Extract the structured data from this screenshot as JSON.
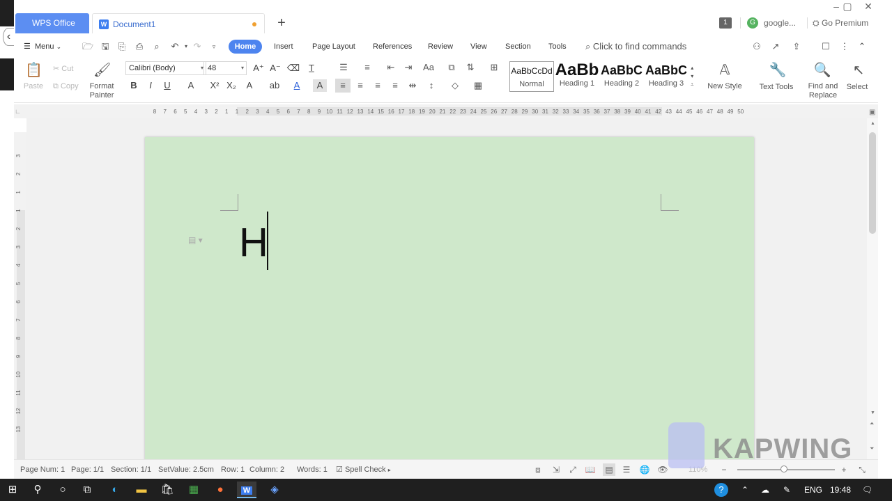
{
  "window": {
    "tabs": [
      {
        "label": "WPS Office"
      },
      {
        "label": "Document1"
      }
    ],
    "badge": "1",
    "account_initial": "G",
    "account_name": "google...",
    "premium": "Go Premium"
  },
  "menubar": {
    "menu_label": "Menu",
    "tabs": [
      "Home",
      "Insert",
      "Page Layout",
      "References",
      "Review",
      "View",
      "Section",
      "Tools"
    ],
    "command_search": "Click to find commands"
  },
  "ribbon": {
    "paste": "Paste",
    "cut": "Cut",
    "copy": "Copy",
    "format_painter": [
      "Format",
      "Painter"
    ],
    "font_name": "Calibri (Body)",
    "font_size": "48",
    "styles": [
      {
        "sample": "AaBbCcDd",
        "label": "Normal"
      },
      {
        "sample": "AaBb",
        "label": "Heading 1"
      },
      {
        "sample": "AaBbC",
        "label": "Heading 2"
      },
      {
        "sample": "AaBbC",
        "label": "Heading 3"
      }
    ],
    "new_style": "New Style",
    "text_tools": "Text Tools",
    "find_replace": [
      "Find and",
      "Replace"
    ],
    "select": "Select"
  },
  "ruler": {
    "ticks": [
      "8",
      "7",
      "6",
      "5",
      "4",
      "3",
      "2",
      "1",
      "1",
      "2",
      "3",
      "4",
      "5",
      "6",
      "7",
      "8",
      "9",
      "10",
      "11",
      "12",
      "13",
      "14",
      "15",
      "16",
      "17",
      "18",
      "19",
      "20",
      "21",
      "22",
      "23",
      "24",
      "25",
      "26",
      "27",
      "28",
      "29",
      "30",
      "31",
      "32",
      "33",
      "34",
      "35",
      "36",
      "37",
      "38",
      "39",
      "40",
      "41",
      "42",
      "43",
      "44",
      "45",
      "46",
      "47",
      "48",
      "49",
      "50"
    ],
    "vticks": [
      "3",
      "2",
      "1",
      "1",
      "2",
      "3",
      "4",
      "5",
      "6",
      "7",
      "8",
      "9",
      "10",
      "11",
      "12",
      "13"
    ]
  },
  "document": {
    "text": "H"
  },
  "statusbar": {
    "page_num": "Page Num: 1",
    "page": "Page: 1/1",
    "section": "Section: 1/1",
    "set_value": "SetValue: 2.5cm",
    "row": "Row: 1",
    "column": "Column: 2",
    "words": "Words: 1",
    "spell_check": "Spell Check",
    "zoom": "110%"
  },
  "watermark": "KAPWING",
  "taskbar": {
    "lang": "ENG",
    "time": "19:48"
  },
  "colors": {
    "accent": "#4d84ef",
    "page_bg": "#cfe8cb",
    "wps_tab": "#5c8ef2"
  }
}
